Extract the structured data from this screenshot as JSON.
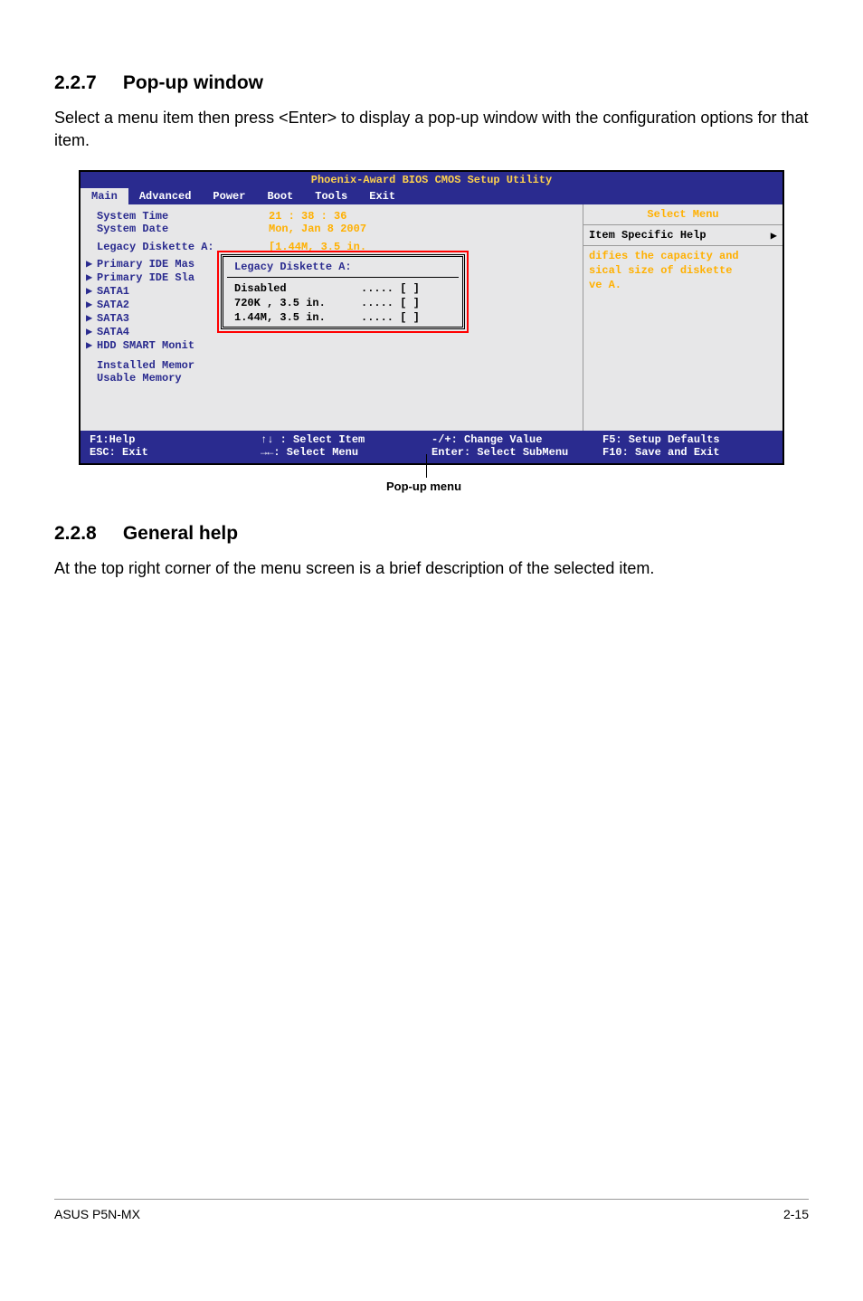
{
  "section1": {
    "number": "2.2.7",
    "title": "Pop-up window",
    "paragraph": "Select a menu item then press <Enter> to display a pop-up window with the configuration options for that item."
  },
  "bios": {
    "title": "Phoenix-Award BIOS CMOS Setup Utility",
    "tabs": [
      "Main",
      "Advanced",
      "Power",
      "Boot",
      "Tools",
      "Exit"
    ],
    "active_tab": "Main",
    "left": {
      "system_time_label": "System Time",
      "system_time_value": "21 : 38 : 36",
      "system_date_label": "System Date",
      "system_date_value": "Mon, Jan  8 2007",
      "legacy_label": "Legacy Diskette A:",
      "legacy_value": "[1.44M, 3.5 in.",
      "items": [
        "Primary IDE Mas",
        "Primary IDE Sla",
        "SATA1",
        "SATA2",
        "SATA3",
        "SATA4",
        "HDD SMART Monit"
      ],
      "installed_mem": "Installed Memor",
      "usable_mem": "Usable Memory"
    },
    "right": {
      "select_menu": "Select Menu",
      "help_head": "Item Specific Help",
      "help_body_l1": "difies the capacity and",
      "help_body_l2": "sical size of diskette",
      "help_body_l3": "ve A."
    },
    "popup": {
      "title": "Legacy Diskette A:",
      "options": [
        {
          "label": "Disabled",
          "dots": "..... [ ]"
        },
        {
          "label": "720K , 3.5 in.",
          "dots": "..... [ ]"
        },
        {
          "label": "1.44M, 3.5 in.",
          "dots": "..... [ ]"
        }
      ]
    },
    "footer": {
      "c1a": "F1:Help",
      "c1b": "ESC: Exit",
      "c2a": "↑↓ : Select Item",
      "c2b": "→←: Select Menu",
      "c3a": "-/+: Change Value",
      "c3b": "Enter: Select SubMenu",
      "c4a": "F5: Setup Defaults",
      "c4b": "F10: Save and Exit"
    }
  },
  "callout": "Pop-up menu",
  "section2": {
    "number": "2.2.8",
    "title": "General help",
    "paragraph": "At the top right corner of the menu screen is a brief description of the selected item."
  },
  "footer": {
    "left": "ASUS P5N-MX",
    "right": "2-15"
  }
}
